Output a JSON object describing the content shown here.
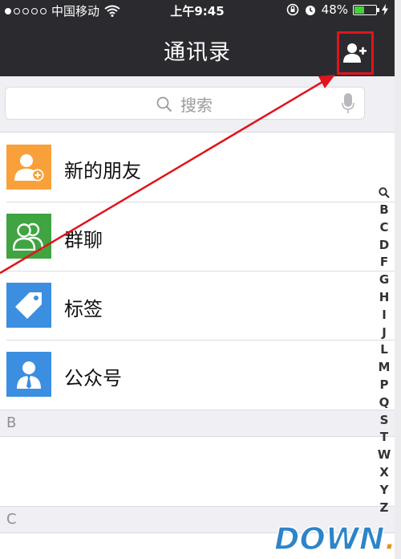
{
  "status_bar": {
    "carrier": "中国移动",
    "time": "上午9:45",
    "battery_percent": "48%",
    "battery_level": 0.48
  },
  "nav": {
    "title": "通讯录"
  },
  "search": {
    "placeholder": "搜索"
  },
  "list": [
    {
      "label": "新的朋友",
      "icon": "new-friend-icon",
      "color": "#f8a13a"
    },
    {
      "label": "群聊",
      "icon": "group-chat-icon",
      "color": "#3fa441"
    },
    {
      "label": "标签",
      "icon": "tag-icon",
      "color": "#3b8ee0"
    },
    {
      "label": "公众号",
      "icon": "official-account-icon",
      "color": "#3b8ee0"
    }
  ],
  "sections": [
    "B",
    "C"
  ],
  "index_letters": [
    "B",
    "C",
    "D",
    "F",
    "G",
    "H",
    "I",
    "J",
    "L",
    "M",
    "P",
    "Q",
    "S",
    "T",
    "W",
    "X",
    "Y",
    "Z"
  ],
  "watermark": "DOWN.cc",
  "colors": {
    "nav_bg": "#2b2b2f",
    "highlight_red": "#e0141b",
    "list_bg": "#efeff4"
  }
}
